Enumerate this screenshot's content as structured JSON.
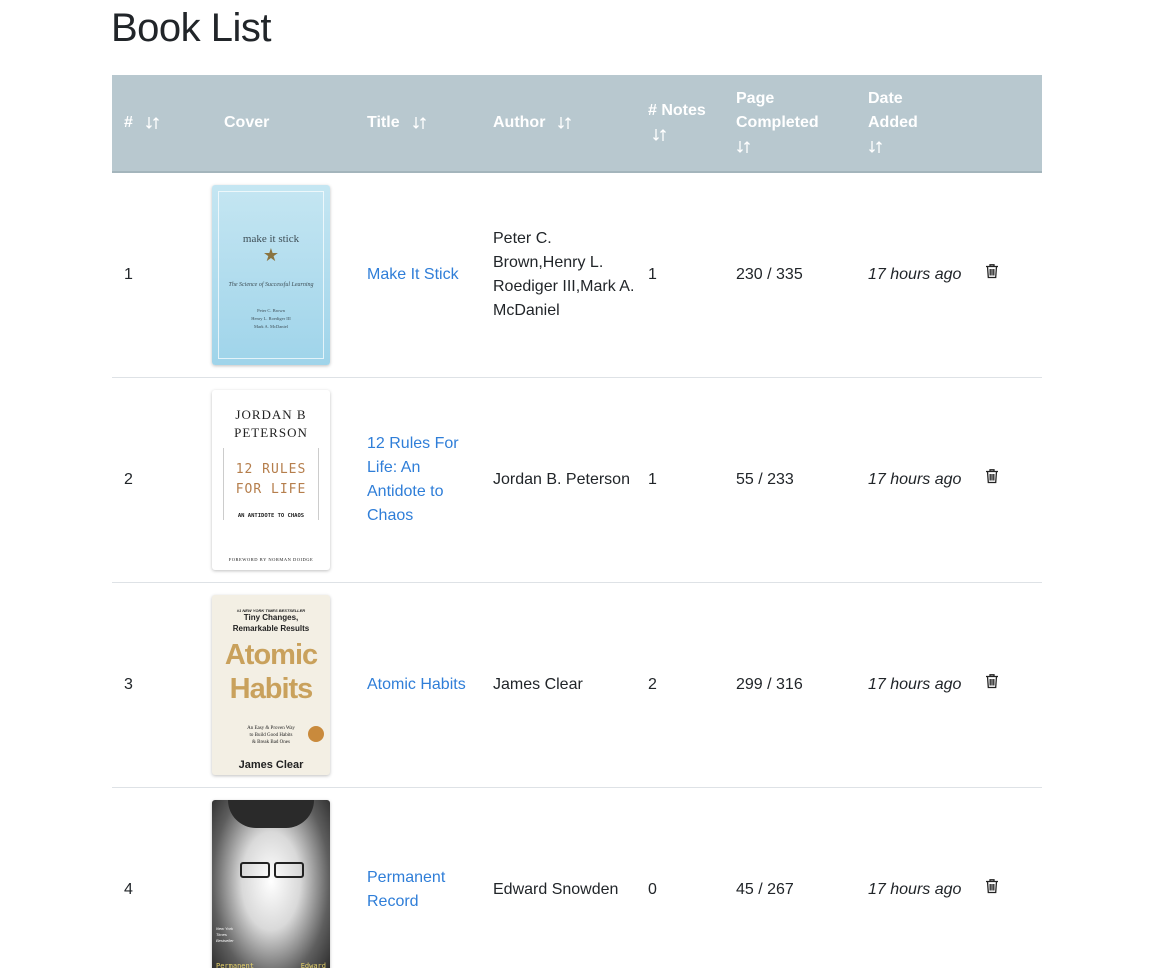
{
  "page": {
    "title": "Book List"
  },
  "table": {
    "headers": {
      "index": "#",
      "cover": "Cover",
      "title": "Title",
      "author": "Author",
      "notes": "# Notes",
      "page_completed": "Page Completed",
      "date_added": "Date Added"
    },
    "rows": [
      {
        "index": "1",
        "title": "Make It Stick",
        "author": "Peter C. Brown,Henry L. Roediger III,Mark A. McDaniel",
        "notes": "1",
        "pages": "230 / 335",
        "date_added": "17 hours ago",
        "cover": {
          "title": "make it stick",
          "subtitle": "The Science of Successful Learning",
          "authors": [
            "Peter C. Brown",
            "Henry L. Roediger III",
            "Mark A. McDaniel"
          ]
        }
      },
      {
        "index": "2",
        "title": "12 Rules For Life: An Antidote to Chaos",
        "author": "Jordan B. Peterson",
        "notes": "1",
        "pages": "55 / 233",
        "date_added": "17 hours ago",
        "cover": {
          "author_line1": "JORDAN B",
          "author_line2": "PETERSON",
          "title_line1": "12 RULES",
          "title_line2": "FOR LIFE",
          "subtitle": "AN ANTIDOTE TO CHAOS",
          "foreword": "FOREWORD BY NORMAN DOIDGE"
        }
      },
      {
        "index": "3",
        "title": "Atomic Habits",
        "author": "James Clear",
        "notes": "2",
        "pages": "299 / 316",
        "date_added": "17 hours ago",
        "cover": {
          "banner": "#1 NEW YORK TIMES BESTSELLER",
          "tagline1": "Tiny Changes,",
          "tagline2": "Remarkable Results",
          "title_line1": "Atomic",
          "title_line2": "Habits",
          "desc1": "An Easy & Proven Way",
          "desc2": "to Build Good Habits",
          "desc3": "& Break Bad Ones",
          "author": "James Clear"
        }
      },
      {
        "index": "4",
        "title": "Permanent Record",
        "author": "Edward Snowden",
        "notes": "0",
        "pages": "45 / 267",
        "date_added": "17 hours ago",
        "cover": {
          "nyt1": "New York",
          "nyt2": "Times",
          "nyt3": "Bestseller",
          "word_left": "Permanent",
          "word_right": "Edward"
        }
      }
    ]
  },
  "icons": {
    "sort": "sort-arrows-icon",
    "delete": "trash-icon"
  },
  "colors": {
    "header_bg": "#b8c8cf",
    "link": "#2f7ed8"
  }
}
